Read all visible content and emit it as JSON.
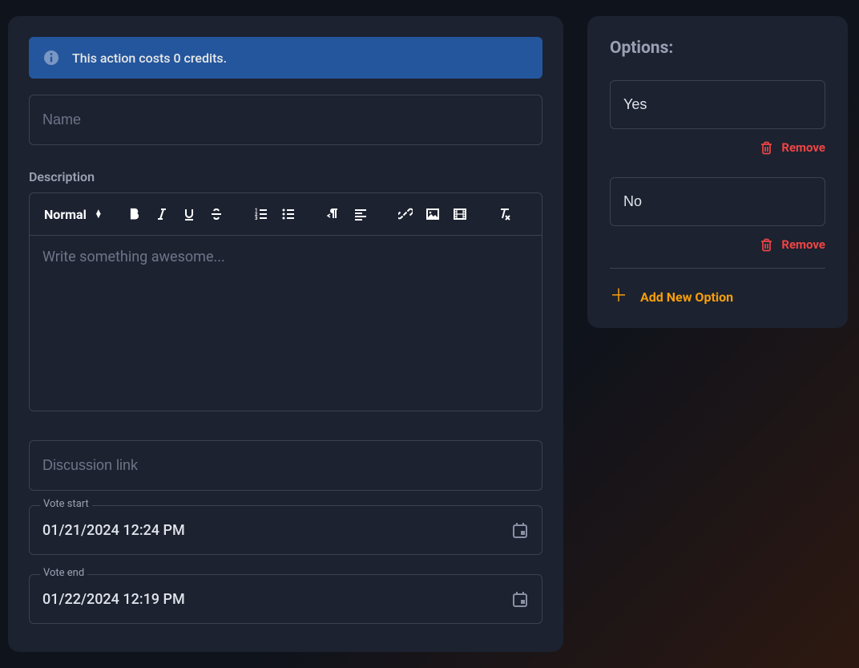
{
  "banner": {
    "text": "This action costs 0 credits."
  },
  "name": {
    "placeholder": "Name",
    "value": ""
  },
  "description": {
    "label": "Description",
    "placeholder": "Write something awesome...",
    "formatSelect": "Normal"
  },
  "discussion": {
    "placeholder": "Discussion link",
    "value": ""
  },
  "voteStart": {
    "label": "Vote start",
    "value": "01/21/2024 12:24 PM"
  },
  "voteEnd": {
    "label": "Vote end",
    "value": "01/22/2024 12:19 PM"
  },
  "options": {
    "title": "Options:",
    "items": [
      {
        "value": "Yes"
      },
      {
        "value": "No"
      }
    ],
    "removeLabel": "Remove",
    "addLabel": "Add New Option"
  }
}
